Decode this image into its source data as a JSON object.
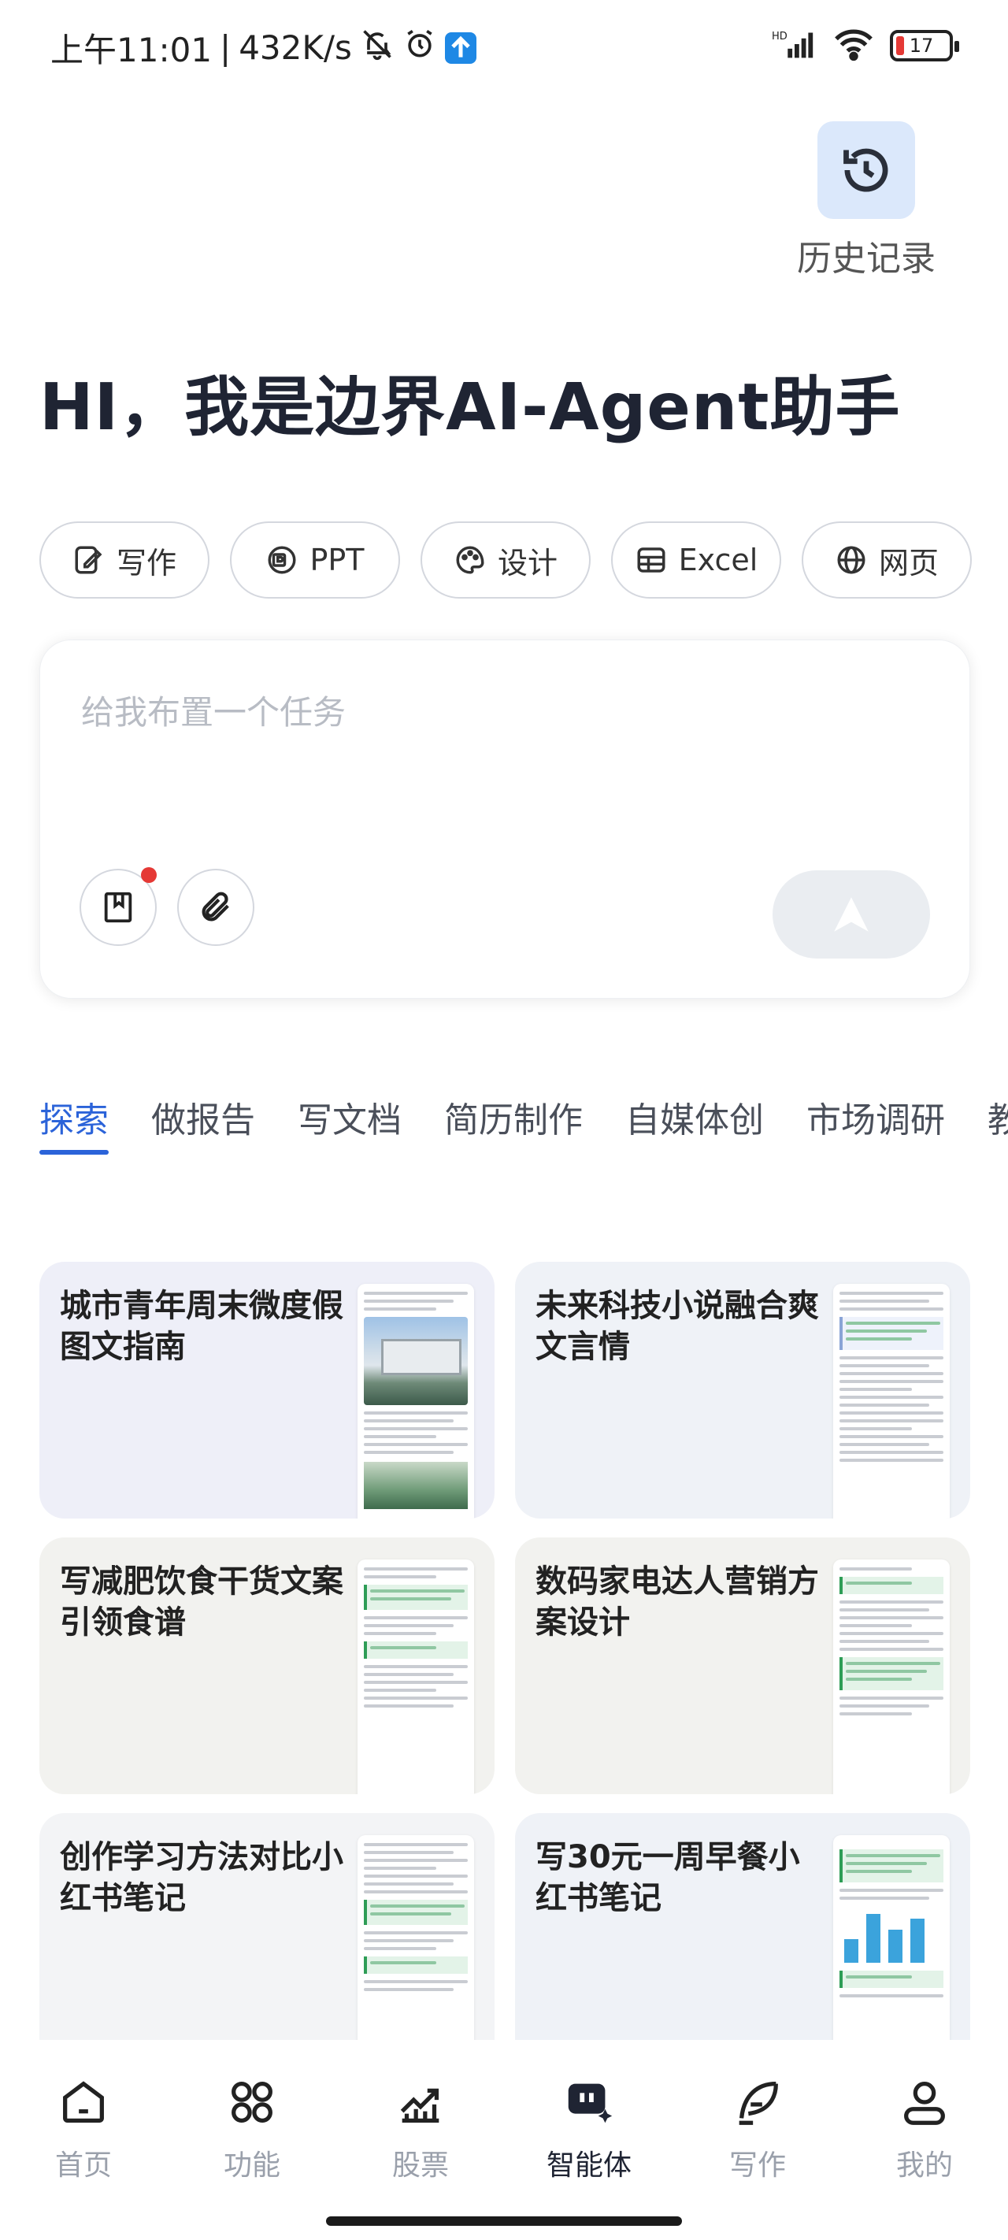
{
  "status_bar": {
    "time": "上午11:01",
    "speed": "432K/s",
    "battery": "17",
    "signal_label": "HD"
  },
  "history": {
    "label": "历史记录",
    "icon": "history-icon"
  },
  "greeting": "HI，我是边界AI-Agent助手",
  "tools": [
    {
      "label": "写作",
      "icon": "pen-icon"
    },
    {
      "label": "PPT",
      "icon": "ppt-icon"
    },
    {
      "label": "设计",
      "icon": "palette-icon"
    },
    {
      "label": "Excel",
      "icon": "table-icon"
    },
    {
      "label": "网页",
      "icon": "globe-icon"
    }
  ],
  "task_input": {
    "placeholder": "给我布置一个任务",
    "value": ""
  },
  "categories": [
    "探索",
    "做报告",
    "写文档",
    "简历制作",
    "自媒体创",
    "市场调研",
    "教学"
  ],
  "active_category": "探索",
  "cards": [
    {
      "title": "城市青年周末微度假图文指南"
    },
    {
      "title": "未来科技小说融合爽文言情"
    },
    {
      "title": "写减肥饮食干货文案引领食谱"
    },
    {
      "title": "数码家电达人营销方案设计"
    },
    {
      "title": "创作学习方法对比小红书笔记"
    },
    {
      "title": "写30元一周早餐小红书笔记"
    }
  ],
  "bottom_nav": [
    {
      "label": "首页",
      "icon": "home-icon"
    },
    {
      "label": "功能",
      "icon": "grid-icon"
    },
    {
      "label": "股票",
      "icon": "stock-chart-icon"
    },
    {
      "label": "智能体",
      "icon": "agent-icon",
      "active": true
    },
    {
      "label": "写作",
      "icon": "quill-icon"
    },
    {
      "label": "我的",
      "icon": "profile-icon"
    }
  ],
  "colors": {
    "accent": "#2b63d9",
    "history_bg": "#dbe8fb",
    "card_bg_1": "#eeeff8",
    "card_bg_2": "#eff2f7",
    "card_bg_3": "#f2f2ef"
  }
}
